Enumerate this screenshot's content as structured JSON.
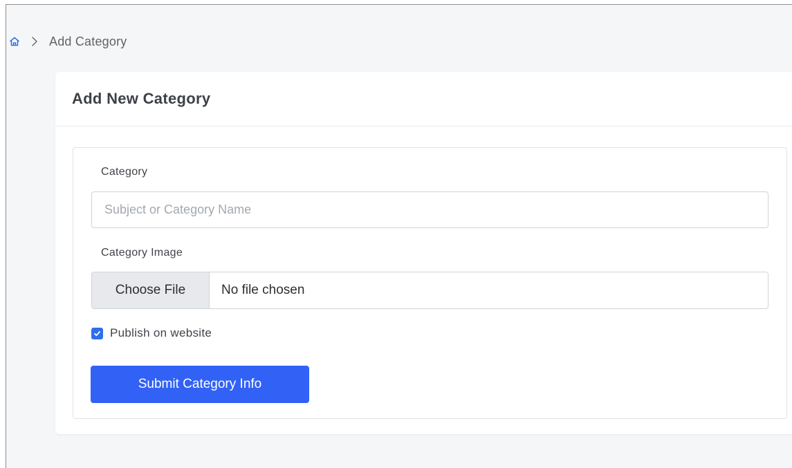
{
  "breadcrumb": {
    "home_icon": "home-icon",
    "separator_icon": "chevron-right-icon",
    "current": "Add Category"
  },
  "card": {
    "title": "Add New Category"
  },
  "form": {
    "category": {
      "label": "Category",
      "value": "",
      "placeholder": "Subject or Category Name"
    },
    "image": {
      "label": "Category Image",
      "button_label": "Choose File",
      "status": "No file chosen"
    },
    "publish": {
      "label": "Publish on website",
      "checked": true
    },
    "submit_label": "Submit Category Info"
  },
  "colors": {
    "accent": "#3161f5",
    "checkbox": "#2f6feb",
    "home_icon": "#2f6feb",
    "background": "#f5f6f8"
  }
}
